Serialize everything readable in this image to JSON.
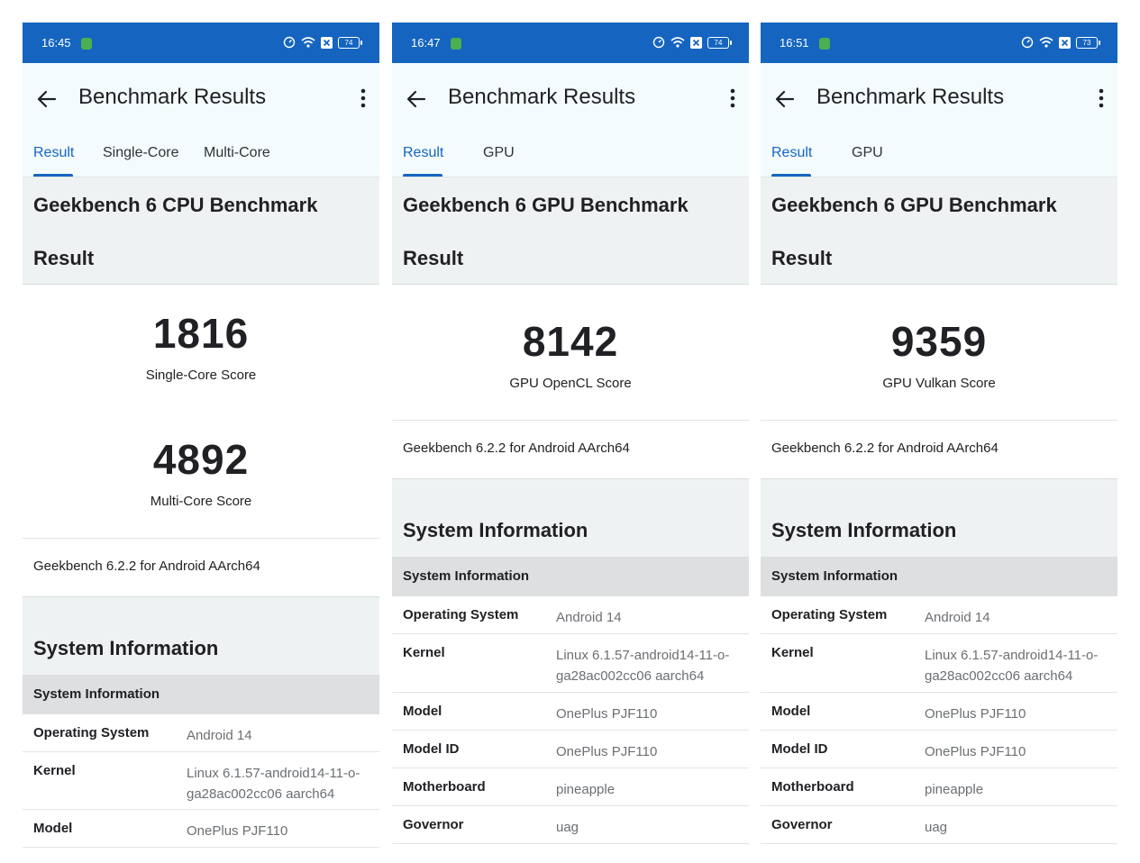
{
  "phones": [
    {
      "status": {
        "time": "16:45",
        "battery": "74"
      },
      "appbar": {
        "title": "Benchmark Results"
      },
      "tabs": [
        "Result",
        "Single-Core",
        "Multi-Core"
      ],
      "benchmark_title": "Geekbench 6 CPU Benchmark",
      "result_label": "Result",
      "scores": [
        {
          "value": "1816",
          "label": "Single-Core Score"
        },
        {
          "value": "4892",
          "label": "Multi-Core Score"
        }
      ],
      "version": "Geekbench 6.2.2 for Android AArch64",
      "system_information_title": "System Information",
      "system_information_subheader": "System Information",
      "info": [
        {
          "key": "Operating System",
          "value": "Android 14"
        },
        {
          "key": "Kernel",
          "value": "Linux 6.1.57-android14-11-o-ga28ac002cc06 aarch64"
        },
        {
          "key": "Model",
          "value": "OnePlus PJF110"
        }
      ]
    },
    {
      "status": {
        "time": "16:47",
        "battery": "74"
      },
      "appbar": {
        "title": "Benchmark Results"
      },
      "tabs": [
        "Result",
        "GPU"
      ],
      "benchmark_title": "Geekbench 6 GPU Benchmark",
      "result_label": "Result",
      "scores": [
        {
          "value": "8142",
          "label": "GPU OpenCL Score"
        }
      ],
      "version": "Geekbench 6.2.2 for Android AArch64",
      "system_information_title": "System Information",
      "system_information_subheader": "System Information",
      "info": [
        {
          "key": "Operating System",
          "value": "Android 14"
        },
        {
          "key": "Kernel",
          "value": "Linux 6.1.57-android14-11-o-ga28ac002cc06 aarch64"
        },
        {
          "key": "Model",
          "value": "OnePlus PJF110"
        },
        {
          "key": "Model ID",
          "value": "OnePlus PJF110"
        },
        {
          "key": "Motherboard",
          "value": "pineapple"
        },
        {
          "key": "Governor",
          "value": "uag"
        }
      ]
    },
    {
      "status": {
        "time": "16:51",
        "battery": "73"
      },
      "appbar": {
        "title": "Benchmark Results"
      },
      "tabs": [
        "Result",
        "GPU"
      ],
      "benchmark_title": "Geekbench 6 GPU Benchmark",
      "result_label": "Result",
      "scores": [
        {
          "value": "9359",
          "label": "GPU Vulkan Score"
        }
      ],
      "version": "Geekbench 6.2.2 for Android AArch64",
      "system_information_title": "System Information",
      "system_information_subheader": "System Information",
      "info": [
        {
          "key": "Operating System",
          "value": "Android 14"
        },
        {
          "key": "Kernel",
          "value": "Linux 6.1.57-android14-11-o-ga28ac002cc06 aarch64"
        },
        {
          "key": "Model",
          "value": "OnePlus PJF110"
        },
        {
          "key": "Model ID",
          "value": "OnePlus PJF110"
        },
        {
          "key": "Motherboard",
          "value": "pineapple"
        },
        {
          "key": "Governor",
          "value": "uag"
        }
      ]
    }
  ],
  "icons": {
    "back": "arrow-back-icon",
    "more": "more-vert-icon",
    "notification": "app-notification-icon",
    "speed": "speedometer-icon",
    "wifi": "wifi-icon",
    "close": "close-box-icon",
    "battery": "battery-icon"
  },
  "colors": {
    "status_bar": "#1565c0",
    "accent": "#1565c0",
    "app_bar": "#f3fbfd",
    "section_bg": "#eff2f2",
    "subheader_bg": "#dedfe0"
  }
}
